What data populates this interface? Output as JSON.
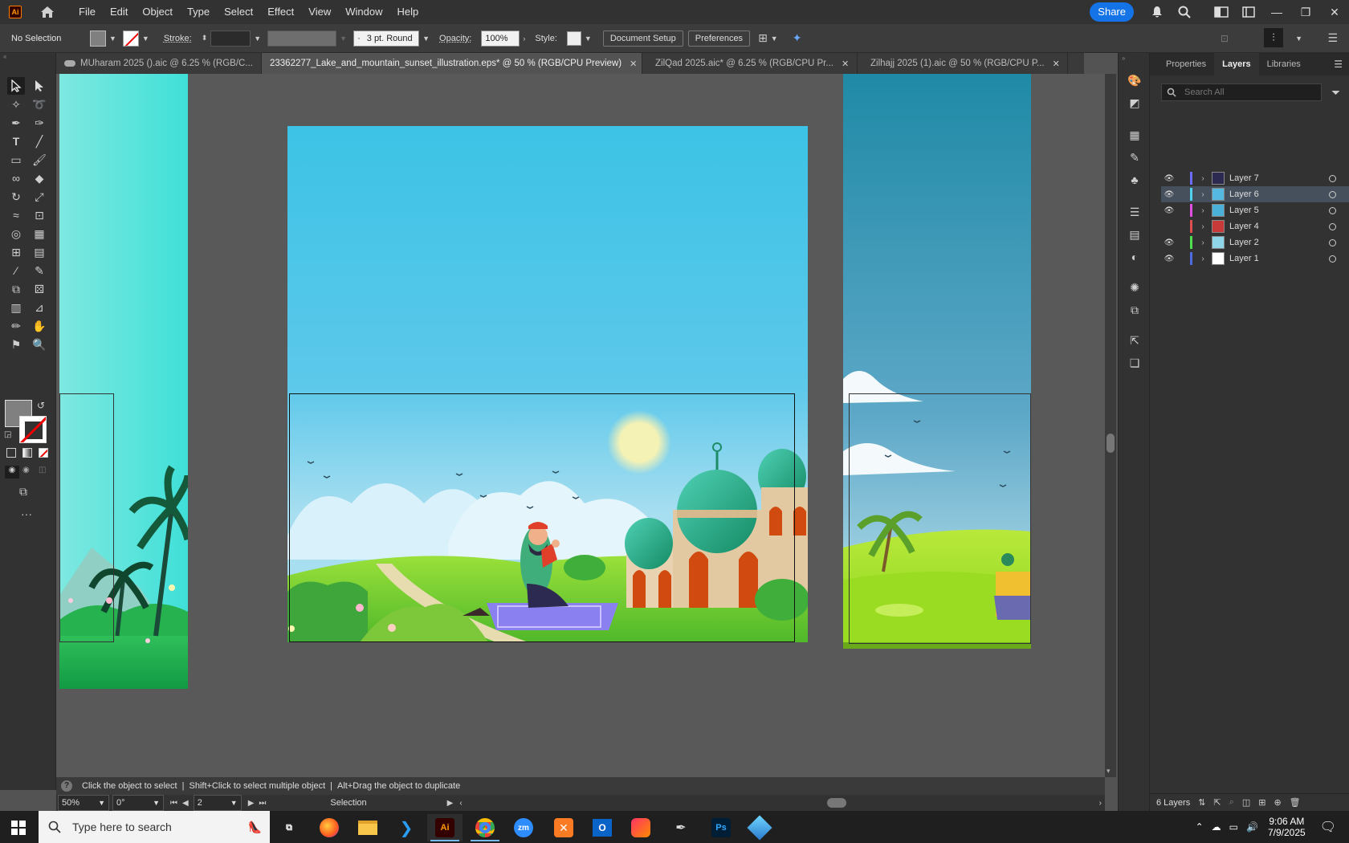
{
  "app": {
    "logo": "Ai",
    "menu": [
      "File",
      "Edit",
      "Object",
      "Type",
      "Select",
      "Effect",
      "View",
      "Window",
      "Help"
    ],
    "share_label": "Share"
  },
  "control_bar": {
    "selection": "No Selection",
    "stroke_label": "Stroke:",
    "brush": "3 pt. Round",
    "opacity_label": "Opacity:",
    "opacity_value": "100%",
    "style_label": "Style:",
    "document_setup": "Document Setup",
    "preferences": "Preferences"
  },
  "tabs": [
    {
      "label": "MUharam 2025 ().aic @ 6.25 % (RGB/C...",
      "cloud": true,
      "active": false
    },
    {
      "label": "23362277_Lake_and_mountain_sunset_illustration.eps* @ 50 % (RGB/CPU Preview)",
      "cloud": false,
      "active": true
    },
    {
      "label": "ZilQad 2025.aic* @ 6.25 % (RGB/CPU Pr...",
      "cloud": true,
      "active": false
    },
    {
      "label": "Zilhajj 2025 (1).aic @ 50 % (RGB/CPU P...",
      "cloud": true,
      "active": false
    }
  ],
  "status": {
    "hint1": "Click the object to select",
    "hint2": "Shift+Click to select multiple object",
    "hint3": "Alt+Drag the object to duplicate",
    "zoom": "50%",
    "rotation": "0°",
    "artboard": "2",
    "tool": "Selection"
  },
  "panel": {
    "tabs": [
      "Properties",
      "Layers",
      "Libraries"
    ],
    "search_placeholder": "Search All",
    "layers": [
      {
        "name": "Layer 7",
        "color": "#6b6bff",
        "visible": true,
        "thumb": "#2c2a50",
        "selected": false
      },
      {
        "name": "Layer 6",
        "color": "#4fd3f0",
        "visible": true,
        "thumb": "#55b8e0",
        "selected": true
      },
      {
        "name": "Layer 5",
        "color": "#e04fe0",
        "visible": true,
        "thumb": "#4ab0d8",
        "selected": false
      },
      {
        "name": "Layer 4",
        "color": "#e04f4f",
        "visible": false,
        "thumb": "#c83a3a",
        "selected": false
      },
      {
        "name": "Layer 2",
        "color": "#4fe04f",
        "visible": true,
        "thumb": "#8fd6e8",
        "selected": false
      },
      {
        "name": "Layer 1",
        "color": "#4f6be0",
        "visible": true,
        "thumb": "#ffffff",
        "selected": false
      }
    ],
    "footer": "6 Layers"
  },
  "taskbar": {
    "search_placeholder": "Type here to search",
    "time": "9:06 AM",
    "date": "7/9/2025",
    "apps": [
      "firefox",
      "file-explorer",
      "vscode",
      "illustrator",
      "chrome",
      "zoom",
      "xampp",
      "outlook",
      "creative-cloud",
      "pen-tool",
      "photoshop",
      "app"
    ]
  }
}
